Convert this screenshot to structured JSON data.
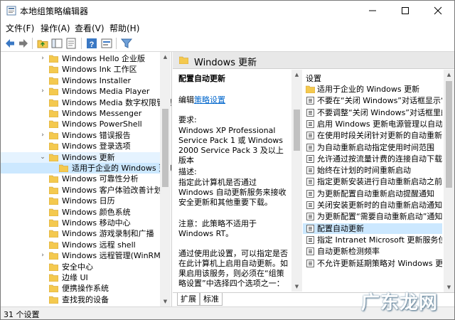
{
  "window": {
    "title": "本地组策略编辑器"
  },
  "menu": [
    "文件(F)",
    "操作(A)",
    "查看(V)",
    "帮助(H)"
  ],
  "tree": {
    "items": [
      {
        "label": "Windows Hello 企业版",
        "expander": "›",
        "state": "normal"
      },
      {
        "label": "Windows Ink 工作区",
        "expander": "",
        "state": "normal"
      },
      {
        "label": "Windows Installer",
        "expander": "",
        "state": "normal"
      },
      {
        "label": "Windows Media Player",
        "expander": "›",
        "state": "normal"
      },
      {
        "label": "Windows Media 数字权限管理",
        "expander": "",
        "state": "normal"
      },
      {
        "label": "Windows Messenger",
        "expander": "",
        "state": "normal"
      },
      {
        "label": "Windows PowerShell",
        "expander": "",
        "state": "normal"
      },
      {
        "label": "Windows 错误报告",
        "expander": "›",
        "state": "normal"
      },
      {
        "label": "Windows 登录选项",
        "expander": "",
        "state": "normal"
      },
      {
        "label": "Windows 更新",
        "expander": "⌄",
        "state": "selected"
      },
      {
        "label": "适用于企业的 Windows 更新",
        "expander": "",
        "state": "child"
      },
      {
        "label": "Windows 可靠性分析",
        "expander": "",
        "state": "normal"
      },
      {
        "label": "Windows 客户体验改善计划",
        "expander": "",
        "state": "normal"
      },
      {
        "label": "Windows 日历",
        "expander": "",
        "state": "normal"
      },
      {
        "label": "Windows 颜色系统",
        "expander": "",
        "state": "normal"
      },
      {
        "label": "Windows 移动中心",
        "expander": "",
        "state": "normal"
      },
      {
        "label": "Windows 游戏录制和广播",
        "expander": "",
        "state": "normal"
      },
      {
        "label": "Windows 远程 shell",
        "expander": "",
        "state": "normal"
      },
      {
        "label": "Windows 远程管理(WinRM)",
        "expander": "›",
        "state": "normal"
      },
      {
        "label": "安全中心",
        "expander": "",
        "state": "normal"
      },
      {
        "label": "边缘 UI",
        "expander": "",
        "state": "normal"
      },
      {
        "label": "便携操作系统",
        "expander": "",
        "state": "normal"
      },
      {
        "label": "查找我的设备",
        "expander": "",
        "state": "normal"
      }
    ]
  },
  "right": {
    "header": "Windows 更新",
    "description": {
      "title": "配置自动更新",
      "edit_prefix": "编辑",
      "edit_link": "策略设置",
      "requirement_label": "要求:",
      "requirement_text": "Windows XP Professional Service Pack 1 或 Windows 2000 Service Pack 3 及以上版本",
      "desc_label": "描述:",
      "desc_text": "指定此计算机是否通过 Windows 自动更新服务来接收安全更新和其他重要下载。",
      "note_text": "注意：此策略不适用于 Windows RT。",
      "usage_text": "通过使用此设置，可以指定是否在此计算机上启用自动更新。如果启用该服务，则必须在“组策略设置”中选择四个选项之一："
    },
    "list": {
      "header": "设置",
      "items": [
        {
          "label": "适用于企业的 Windows 更新",
          "kind": "folder"
        },
        {
          "label": "不要在“关闭 Windows”对话框显示“安装更新并关机”",
          "kind": "policy"
        },
        {
          "label": "不要调整“关闭 Windows”对话框里的“安装更新并关机”的默认选项",
          "kind": "policy"
        },
        {
          "label": "启用 Windows 更新电源管理以自动唤醒系统来安装计划的更新",
          "kind": "policy"
        },
        {
          "label": "在使用时段关闭针对更新的自动重新启动",
          "kind": "policy"
        },
        {
          "label": "为自动重新启动指定使用时间范围",
          "kind": "policy"
        },
        {
          "label": "允许通过按流量计费的连接自动下载更新",
          "kind": "policy"
        },
        {
          "label": "始终在计划的时间重新启动",
          "kind": "policy"
        },
        {
          "label": "指定更新安装进行自动重新启动之前的最后期限",
          "kind": "policy"
        },
        {
          "label": "为更新配置自动重新启动提醒通知",
          "kind": "policy"
        },
        {
          "label": "关闭安装更新时的自动重新启动通知",
          "kind": "policy"
        },
        {
          "label": "为更新配置“需要自动重新启动”通知",
          "kind": "policy"
        },
        {
          "label": "配置自动更新",
          "kind": "policy",
          "selected": true
        },
        {
          "label": "指定 Intranet Microsoft 更新服务位置",
          "kind": "policy"
        },
        {
          "label": "自动更新检测频率",
          "kind": "policy"
        },
        {
          "label": "不允许更新延期策略对 Windows 更新执行扫描",
          "kind": "policy"
        }
      ]
    },
    "tabs": [
      "扩展",
      "标准"
    ]
  },
  "status": {
    "text": "31 个设置"
  },
  "watermark": "广东龙网",
  "colors": {
    "selection": "#cce8ff",
    "folder": "#f4c94f",
    "link": "#0066cc"
  }
}
